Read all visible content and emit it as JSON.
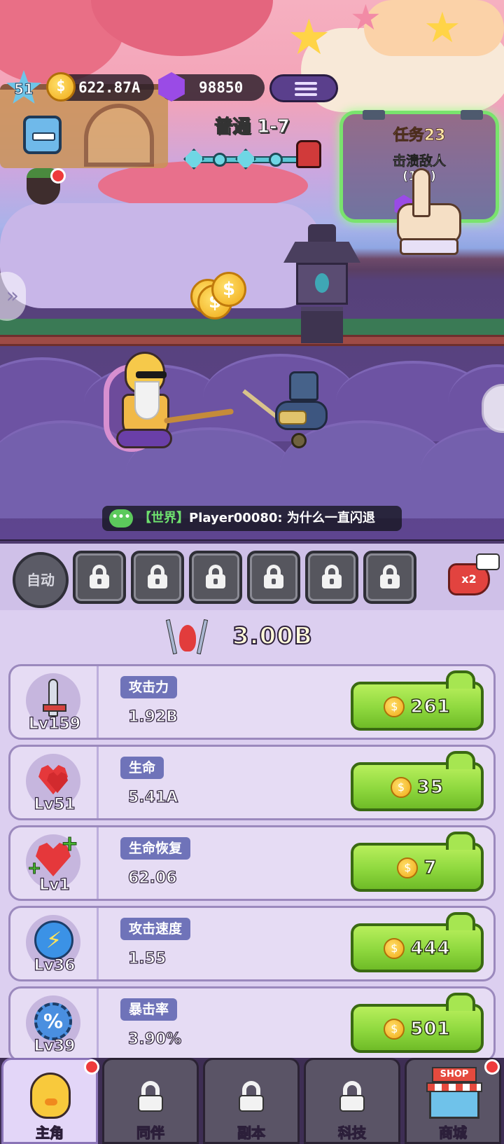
{
  "hud": {
    "level": "51",
    "gold": "622.87A",
    "gems": "98850",
    "stage_title": "普通 1-7"
  },
  "quest": {
    "title": "任务23",
    "description": "击溃敌人",
    "progress": "(1/5)"
  },
  "chat": {
    "channel": "【世界】",
    "message": "Player00080: 为什么一直闪退"
  },
  "skills": {
    "auto_label": "自动",
    "slots": [
      {
        "locked": true
      },
      {
        "locked": true
      },
      {
        "locked": true
      },
      {
        "locked": true
      },
      {
        "locked": true
      },
      {
        "locked": true
      }
    ],
    "speed_label": "x2"
  },
  "power": {
    "value": "3.00B",
    "icon": "power-swords-icon"
  },
  "stats": [
    {
      "name": "攻击力",
      "level": "Lv159",
      "value": "1.92B",
      "cost": "261",
      "icon": "sword-icon"
    },
    {
      "name": "生命",
      "level": "Lv51",
      "value": "5.41A",
      "cost": "35",
      "icon": "heart-icon"
    },
    {
      "name": "生命恢复",
      "level": "Lv1",
      "value": "62.06",
      "cost": "7",
      "icon": "heart-regen-icon"
    },
    {
      "name": "攻击速度",
      "level": "Lv36",
      "value": "1.55",
      "cost": "444",
      "icon": "lightning-icon"
    },
    {
      "name": "暴击率",
      "level": "Lv39",
      "value": "3.90%",
      "cost": "501",
      "icon": "crit-gear-icon"
    }
  ],
  "nav": {
    "tabs": [
      {
        "label": "主角",
        "active": true,
        "locked": false,
        "badge": true
      },
      {
        "label": "同伴",
        "active": false,
        "locked": true,
        "badge": false
      },
      {
        "label": "副本",
        "active": false,
        "locked": true,
        "badge": false
      },
      {
        "label": "科技",
        "active": false,
        "locked": true,
        "badge": false
      },
      {
        "label": "商城",
        "active": false,
        "locked": false,
        "badge": true
      }
    ],
    "shop_sign": "SHOP"
  },
  "coin_symbol": "$"
}
